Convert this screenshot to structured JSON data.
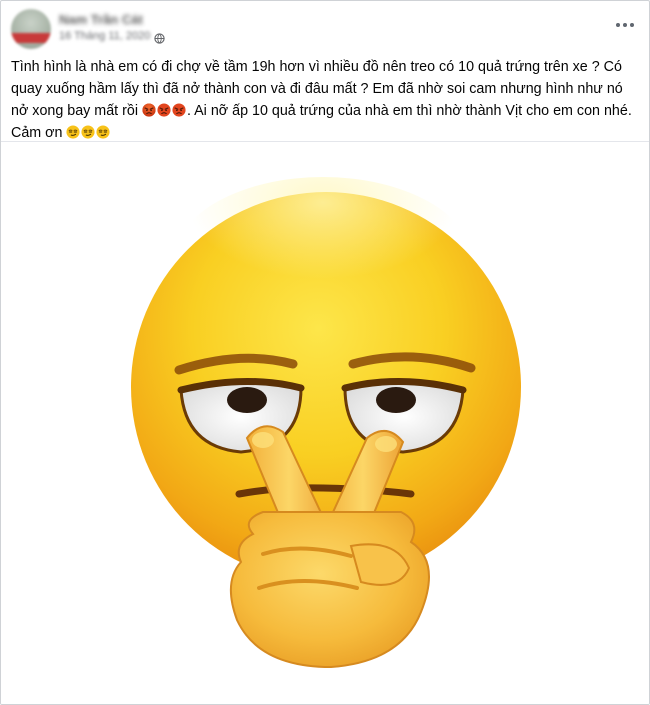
{
  "post": {
    "author_name": "Nam Trần Cát",
    "date": "16 Tháng 11, 2020",
    "privacy_icon": "globe-icon",
    "more_icon": "more-options-icon",
    "text_line_1": "Tình hình là nhà em có đi chợ về tầm 19h hơn vì nhiều đồ nên treo có 10 quả trứng trên xe ? Có quay xuống hầm lấy thì đã nở thành con và đi đâu mất ? Em đã nhờ soi cam nhưng hình như nó nở xong bay mất rồi",
    "text_line_2": ". Ai nỡ ấp 10 quả trứng của nhà em thì nhờ thành Vịt cho em con nhé. Cảm ơn",
    "angry_emoji_count": 3,
    "smirk_emoji_count": 3,
    "image": {
      "subject": "emoji-face-peace-sign-eyes",
      "face_color": "#f7c21a",
      "background_color": "#ffffff"
    }
  }
}
